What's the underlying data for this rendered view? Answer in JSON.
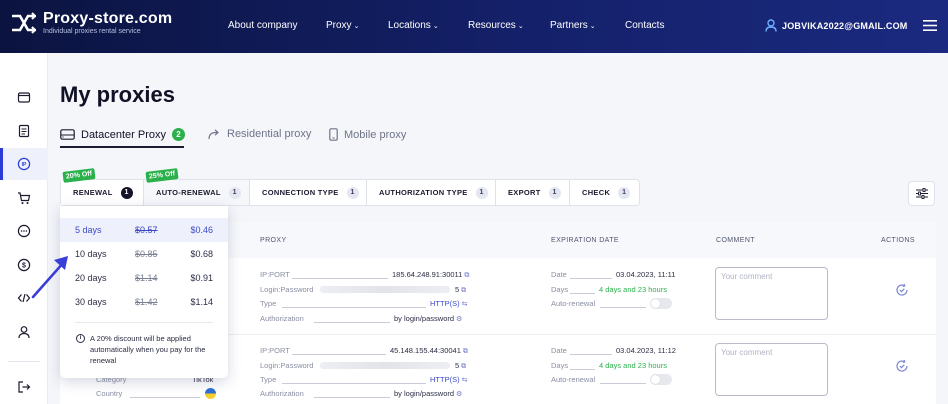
{
  "header": {
    "logo_title": "Proxy-store.com",
    "logo_subtitle": "Individual proxies rental service",
    "nav": [
      {
        "label": "About company",
        "has_dropdown": false
      },
      {
        "label": "Proxy",
        "has_dropdown": true
      },
      {
        "label": "Locations",
        "has_dropdown": true
      },
      {
        "label": "Resources",
        "has_dropdown": true
      },
      {
        "label": "Partners",
        "has_dropdown": true
      },
      {
        "label": "Contacts",
        "has_dropdown": false
      }
    ],
    "user_email": "JOBVIKA2022@GMAIL.COM"
  },
  "sidebar": {
    "items": [
      {
        "icon": "folder-icon"
      },
      {
        "icon": "document-icon"
      },
      {
        "icon": "ip-icon",
        "active": true
      },
      {
        "icon": "cart-icon"
      },
      {
        "icon": "chat-icon"
      },
      {
        "icon": "dollar-icon"
      },
      {
        "icon": "code-icon"
      },
      {
        "icon": "user-icon"
      },
      {
        "icon": "logout-icon"
      }
    ]
  },
  "page": {
    "title": "My proxies",
    "tabs": [
      {
        "label": "Datacenter Proxy",
        "badge": "2",
        "active": true
      },
      {
        "label": "Residential proxy"
      },
      {
        "label": "Mobile proxy"
      }
    ]
  },
  "filters": {
    "tabs": [
      {
        "label": "RENEWAL",
        "count": "1",
        "promo": "20% Off"
      },
      {
        "label": "AUTO-RENEWAL",
        "count": "1",
        "promo": "25% Off"
      },
      {
        "label": "CONNECTION TYPE",
        "count": "1"
      },
      {
        "label": "AUTHORIZATION TYPE",
        "count": "1"
      },
      {
        "label": "EXPORT",
        "count": "1"
      },
      {
        "label": "CHECK",
        "count": "1"
      }
    ]
  },
  "renewal_dropdown": {
    "options": [
      {
        "days": "5 days",
        "old_price": "$0.57",
        "price": "$0.46",
        "selected": true
      },
      {
        "days": "10 days",
        "old_price": "$0.85",
        "price": "$0.68"
      },
      {
        "days": "20 days",
        "old_price": "$1.14",
        "price": "$0.91"
      },
      {
        "days": "30 days",
        "old_price": "$1.42",
        "price": "$1.14"
      }
    ],
    "note": "A 20% discount will be applied automatically when you pay for the renewal",
    "note_icon": "i"
  },
  "table": {
    "headers": {
      "proxy": "PROXY",
      "expiration": "EXPIRATION DATE",
      "comment": "COMMENT",
      "actions": "ACTIONS"
    },
    "labels": {
      "ip_port": "IP:PORT",
      "login_password": "Login:Password",
      "type": "Type",
      "authorization": "Authorization",
      "date": "Date",
      "days": "Days",
      "auto_renewal": "Auto-renewal",
      "category": "Category",
      "country": "Country",
      "comment_placeholder": "Your comment"
    },
    "rows": [
      {
        "ip_port": "185.64.248.91:30011",
        "login_password_suffix": "5",
        "type": "HTTP(S)",
        "authorization": "by login/password",
        "date": "03.04.2023, 11:11",
        "days": "4 days and 23 hours"
      },
      {
        "ip_port": "45.148.155.44:30041",
        "login_password_suffix": "5",
        "type": "HTTP(S)",
        "authorization": "by login/password",
        "date": "03.04.2023, 11:12",
        "days": "4 days and 23 hours",
        "category": "TikTok"
      }
    ]
  },
  "colors": {
    "header_bg": "#142069",
    "accent": "#2b3cd6",
    "green": "#2bb14c"
  }
}
